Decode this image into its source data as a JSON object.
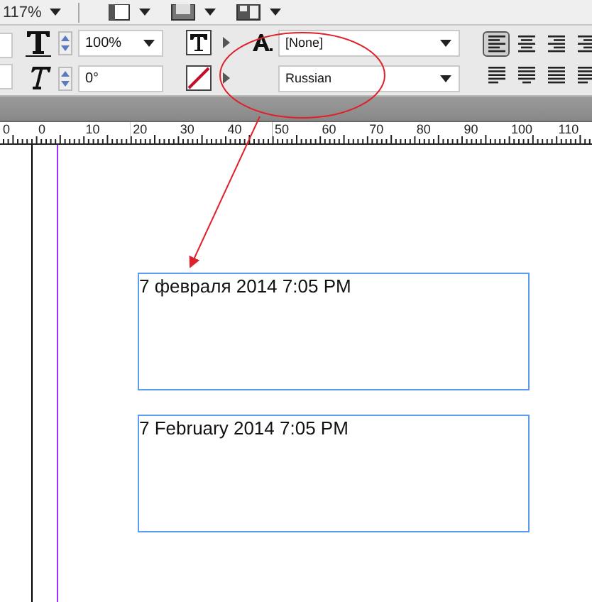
{
  "zoom": {
    "value": "117%"
  },
  "toolbar": {
    "scale_field": {
      "value": "100%"
    },
    "skew_field": {
      "value": "0°"
    },
    "character_style": {
      "value": "[None]"
    },
    "language": {
      "value": "Russian"
    },
    "align_buttons": [
      {
        "kind": "left",
        "selected": true
      },
      {
        "kind": "center",
        "selected": false
      },
      {
        "kind": "right",
        "selected": false
      },
      {
        "kind": "right",
        "selected": false
      },
      {
        "kind": "justify-left",
        "selected": false
      },
      {
        "kind": "justify-center",
        "selected": false
      },
      {
        "kind": "justify-all",
        "selected": false
      },
      {
        "kind": "justify-left",
        "selected": false
      }
    ]
  },
  "ruler": {
    "labels": [
      "0",
      "0",
      "10",
      "20",
      "30",
      "40",
      "50",
      "60",
      "70",
      "80",
      "90",
      "100",
      "110"
    ]
  },
  "text_frames": [
    {
      "text": "7 февраля 2014 7:05 PM"
    },
    {
      "text": "7 February 2014 7:05 PM"
    }
  ]
}
